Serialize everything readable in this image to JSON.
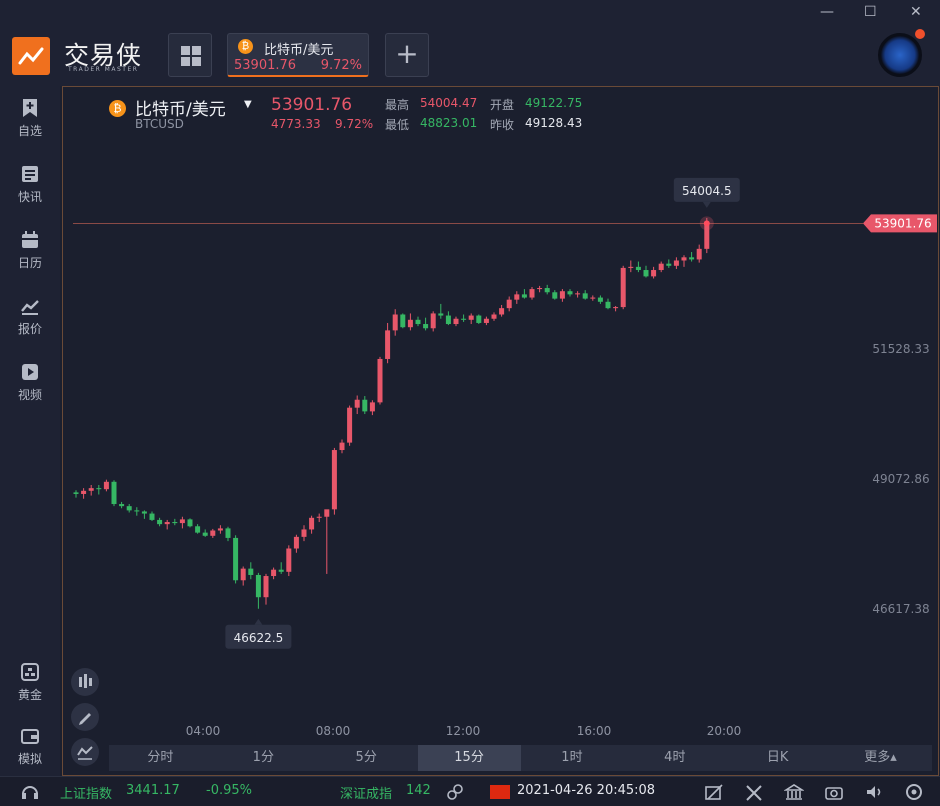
{
  "window": {
    "minimize": "—",
    "maximize": "☐",
    "close": "✕"
  },
  "brand": {
    "name": "交易侠",
    "sub": "TRADER MASTER"
  },
  "tab": {
    "coin_glyph": "₿",
    "title": "比特币/美元",
    "price": "53901.76",
    "pct": "9.72%"
  },
  "add_label": "+",
  "sidebar": {
    "items": [
      {
        "label": "自选",
        "icon": "bookmark-plus-icon"
      },
      {
        "label": "快讯",
        "icon": "news-icon"
      },
      {
        "label": "日历",
        "icon": "calendar-icon"
      },
      {
        "label": "报价",
        "icon": "quote-chart-icon"
      },
      {
        "label": "视频",
        "icon": "video-play-icon"
      },
      {
        "label": "黄金",
        "icon": "gold-bars-icon"
      },
      {
        "label": "模拟",
        "icon": "wallet-icon"
      }
    ]
  },
  "header": {
    "name": "比特币/美元",
    "symbol": "BTCUSD",
    "price": "53901.76",
    "change": "4773.33",
    "pct": "9.72%",
    "high_label": "最高",
    "high": "54004.47",
    "open_label": "开盘",
    "open": "49122.75",
    "low_label": "最低",
    "low": "48823.01",
    "prev_label": "昨收",
    "prev": "49128.43"
  },
  "chart_data": {
    "type": "candlestick",
    "y_ticks": [
      46617.38,
      49072.86,
      51528.33
    ],
    "current_price": "53901.76",
    "high_marker": "54004.5",
    "low_marker": "46622.5",
    "x_ticks": [
      "04:00",
      "08:00",
      "12:00",
      "16:00",
      "20:00"
    ],
    "ohlc": [
      [
        48820,
        48860,
        48720,
        48790
      ],
      [
        48790,
        48900,
        48700,
        48850
      ],
      [
        48850,
        48960,
        48760,
        48900
      ],
      [
        48900,
        48960,
        48780,
        48880
      ],
      [
        48880,
        49060,
        48840,
        49020
      ],
      [
        49020,
        49050,
        48560,
        48600
      ],
      [
        48600,
        48640,
        48520,
        48560
      ],
      [
        48560,
        48600,
        48440,
        48480
      ],
      [
        48480,
        48540,
        48380,
        48460
      ],
      [
        48460,
        48480,
        48320,
        48420
      ],
      [
        48420,
        48460,
        48280,
        48300
      ],
      [
        48300,
        48340,
        48180,
        48220
      ],
      [
        48220,
        48300,
        48120,
        48260
      ],
      [
        48260,
        48320,
        48200,
        48240
      ],
      [
        48240,
        48360,
        48140,
        48310
      ],
      [
        48310,
        48330,
        48160,
        48180
      ],
      [
        48180,
        48220,
        48040,
        48060
      ],
      [
        48060,
        48120,
        47980,
        48000
      ],
      [
        48000,
        48130,
        47960,
        48100
      ],
      [
        48100,
        48200,
        48040,
        48140
      ],
      [
        48140,
        48170,
        47900,
        47960
      ],
      [
        47960,
        48010,
        47100,
        47160
      ],
      [
        47160,
        47420,
        47060,
        47380
      ],
      [
        47380,
        47500,
        47180,
        47260
      ],
      [
        47260,
        47300,
        46622,
        46840
      ],
      [
        46840,
        47280,
        46700,
        47240
      ],
      [
        47240,
        47400,
        47180,
        47360
      ],
      [
        47360,
        47500,
        47280,
        47320
      ],
      [
        47320,
        47820,
        47240,
        47760
      ],
      [
        47760,
        48020,
        47680,
        47980
      ],
      [
        47980,
        48200,
        47900,
        48120
      ],
      [
        48120,
        48380,
        48040,
        48340
      ],
      [
        48340,
        48420,
        48260,
        48360
      ],
      [
        48360,
        48460,
        47280,
        48500
      ],
      [
        48500,
        49660,
        48400,
        49620
      ],
      [
        49620,
        49820,
        49560,
        49760
      ],
      [
        49760,
        50460,
        49700,
        50420
      ],
      [
        50420,
        50650,
        50300,
        50570
      ],
      [
        50570,
        50640,
        50300,
        50350
      ],
      [
        50350,
        50560,
        50280,
        50520
      ],
      [
        50520,
        51380,
        50480,
        51340
      ],
      [
        51340,
        52020,
        51260,
        51880
      ],
      [
        51880,
        52280,
        51780,
        52180
      ],
      [
        52180,
        52200,
        51920,
        51940
      ],
      [
        51940,
        52200,
        51880,
        52080
      ],
      [
        52080,
        52140,
        51960,
        52000
      ],
      [
        52000,
        52120,
        51880,
        51920
      ],
      [
        51920,
        52240,
        51860,
        52200
      ],
      [
        52200,
        52380,
        52100,
        52160
      ],
      [
        52160,
        52240,
        51980,
        52000
      ],
      [
        52000,
        52140,
        51960,
        52100
      ],
      [
        52100,
        52180,
        52040,
        52080
      ],
      [
        52080,
        52200,
        52000,
        52160
      ],
      [
        52160,
        52180,
        52000,
        52020
      ],
      [
        52020,
        52140,
        51980,
        52100
      ],
      [
        52100,
        52220,
        52060,
        52180
      ],
      [
        52180,
        52360,
        52140,
        52300
      ],
      [
        52300,
        52520,
        52240,
        52460
      ],
      [
        52460,
        52620,
        52380,
        52560
      ],
      [
        52560,
        52660,
        52480,
        52500
      ],
      [
        52500,
        52700,
        52460,
        52660
      ],
      [
        52660,
        52720,
        52600,
        52680
      ],
      [
        52680,
        52740,
        52560,
        52600
      ],
      [
        52600,
        52640,
        52460,
        52480
      ],
      [
        52480,
        52660,
        52420,
        52620
      ],
      [
        52620,
        52660,
        52520,
        52560
      ],
      [
        52560,
        52620,
        52500,
        52580
      ],
      [
        52580,
        52640,
        52460,
        52480
      ],
      [
        52480,
        52540,
        52440,
        52500
      ],
      [
        52500,
        52540,
        52380,
        52420
      ],
      [
        52420,
        52480,
        52280,
        52300
      ],
      [
        52300,
        52340,
        52240,
        52320
      ],
      [
        52320,
        53100,
        52280,
        53060
      ],
      [
        53060,
        53200,
        52980,
        53080
      ],
      [
        53080,
        53180,
        52980,
        53020
      ],
      [
        53020,
        53100,
        52880,
        52900
      ],
      [
        52900,
        53080,
        52860,
        53020
      ],
      [
        53020,
        53180,
        52980,
        53140
      ],
      [
        53140,
        53220,
        53060,
        53100
      ],
      [
        53100,
        53260,
        53040,
        53200
      ],
      [
        53200,
        53300,
        53080,
        53260
      ],
      [
        53260,
        53360,
        53180,
        53220
      ],
      [
        53220,
        53500,
        53160,
        53420
      ],
      [
        53420,
        54004,
        53340,
        53902
      ]
    ]
  },
  "timeframes": [
    "分时",
    "1分",
    "5分",
    "15分",
    "1时",
    "4时",
    "日K",
    "更多▴"
  ],
  "active_timeframe": 3,
  "status": {
    "sh_label": "上证指数",
    "sh_val": "3441.17",
    "sh_pct": "-0.95%",
    "sz_label": "深证成指",
    "sz_val": "142",
    "datetime": "2021-04-26 20:45:08"
  },
  "colors": {
    "up": "#e8576a",
    "down": "#36b764",
    "accent": "#f0701e",
    "bg": "#1b1f2e"
  }
}
